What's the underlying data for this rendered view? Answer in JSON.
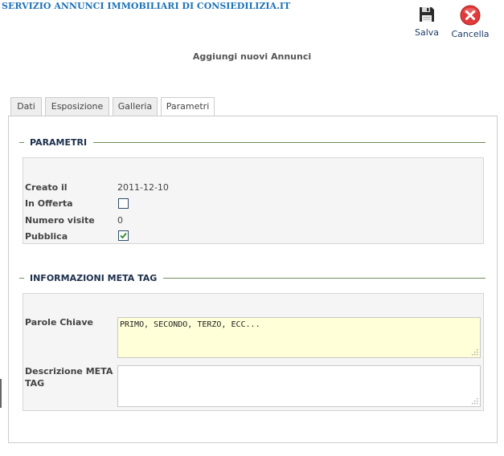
{
  "header": {
    "site_title": "SERVIZIO ANNUNCI IMMOBILIARI DI CONSIEDILIZIA.IT",
    "page_title": "Aggiungi nuovi Annunci"
  },
  "toolbar": {
    "save_label": "Salva",
    "save_icon": "floppy-disk-icon",
    "cancel_label": "Cancella",
    "cancel_icon": "close-circle-icon",
    "cancel_color": "#e03a3a"
  },
  "tabs": [
    {
      "label": "Dati",
      "active": false
    },
    {
      "label": "Esposizione",
      "active": false
    },
    {
      "label": "Galleria",
      "active": false
    },
    {
      "label": "Parametri",
      "active": true
    }
  ],
  "parametri": {
    "legend": "PARAMETRI",
    "creato_il_label": "Creato il",
    "creato_il_value": "2011-12-10",
    "in_offerta_label": "In Offerta",
    "in_offerta_checked": false,
    "numero_visite_label": "Numero visite",
    "numero_visite_value": "0",
    "pubblica_label": "Pubblica",
    "pubblica_checked": true
  },
  "meta": {
    "legend": "INFORMAZIONI META TAG",
    "parole_chiave_label": "Parole Chiave",
    "parole_chiave_value": "PRIMO, SECONDO, TERZO, ECC...",
    "descrizione_label_line1": "Descrizione META",
    "descrizione_label_line2": "TAG",
    "descrizione_value": ""
  },
  "colors": {
    "accent_blue": "#1f73b7",
    "legend_line": "#6f8e5b",
    "highlight_input": "#ffffd8"
  }
}
